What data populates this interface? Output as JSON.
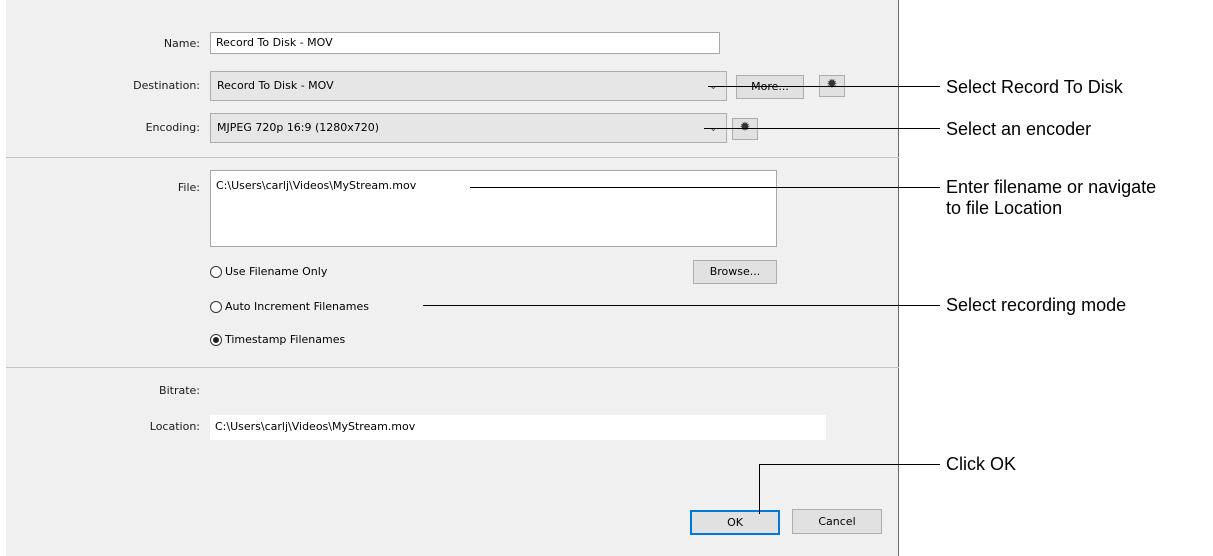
{
  "form": {
    "name_label": "Name:",
    "name_value": "Record To Disk - MOV",
    "destination_label": "Destination:",
    "destination_value": "Record To Disk - MOV",
    "more_button": "More...",
    "encoding_label": "Encoding:",
    "encoding_value": "MJPEG 720p 16:9 (1280x720)",
    "file_label": "File:",
    "file_value": "C:\\Users\\carlj\\Videos\\MyStream.mov",
    "browse_button": "Browse...",
    "radios": [
      {
        "label": "Use Filename Only",
        "selected": false
      },
      {
        "label": "Auto Increment Filenames",
        "selected": false
      },
      {
        "label": "Timestamp Filenames",
        "selected": true
      }
    ],
    "bitrate_label": "Bitrate:",
    "location_label": "Location:",
    "location_value": "C:\\Users\\carlj\\Videos\\MyStream.mov",
    "ok_button": "OK",
    "cancel_button": "Cancel",
    "dropdown_icon": "chevron-down-icon",
    "settings_icon": "gear-icon"
  },
  "callouts": {
    "destination": "Select Record To Disk",
    "encoder": "Select an encoder",
    "file_line1": "Enter filename or navigate",
    "file_line2": "to file Location",
    "mode": "Select recording mode",
    "ok": "Click OK"
  }
}
